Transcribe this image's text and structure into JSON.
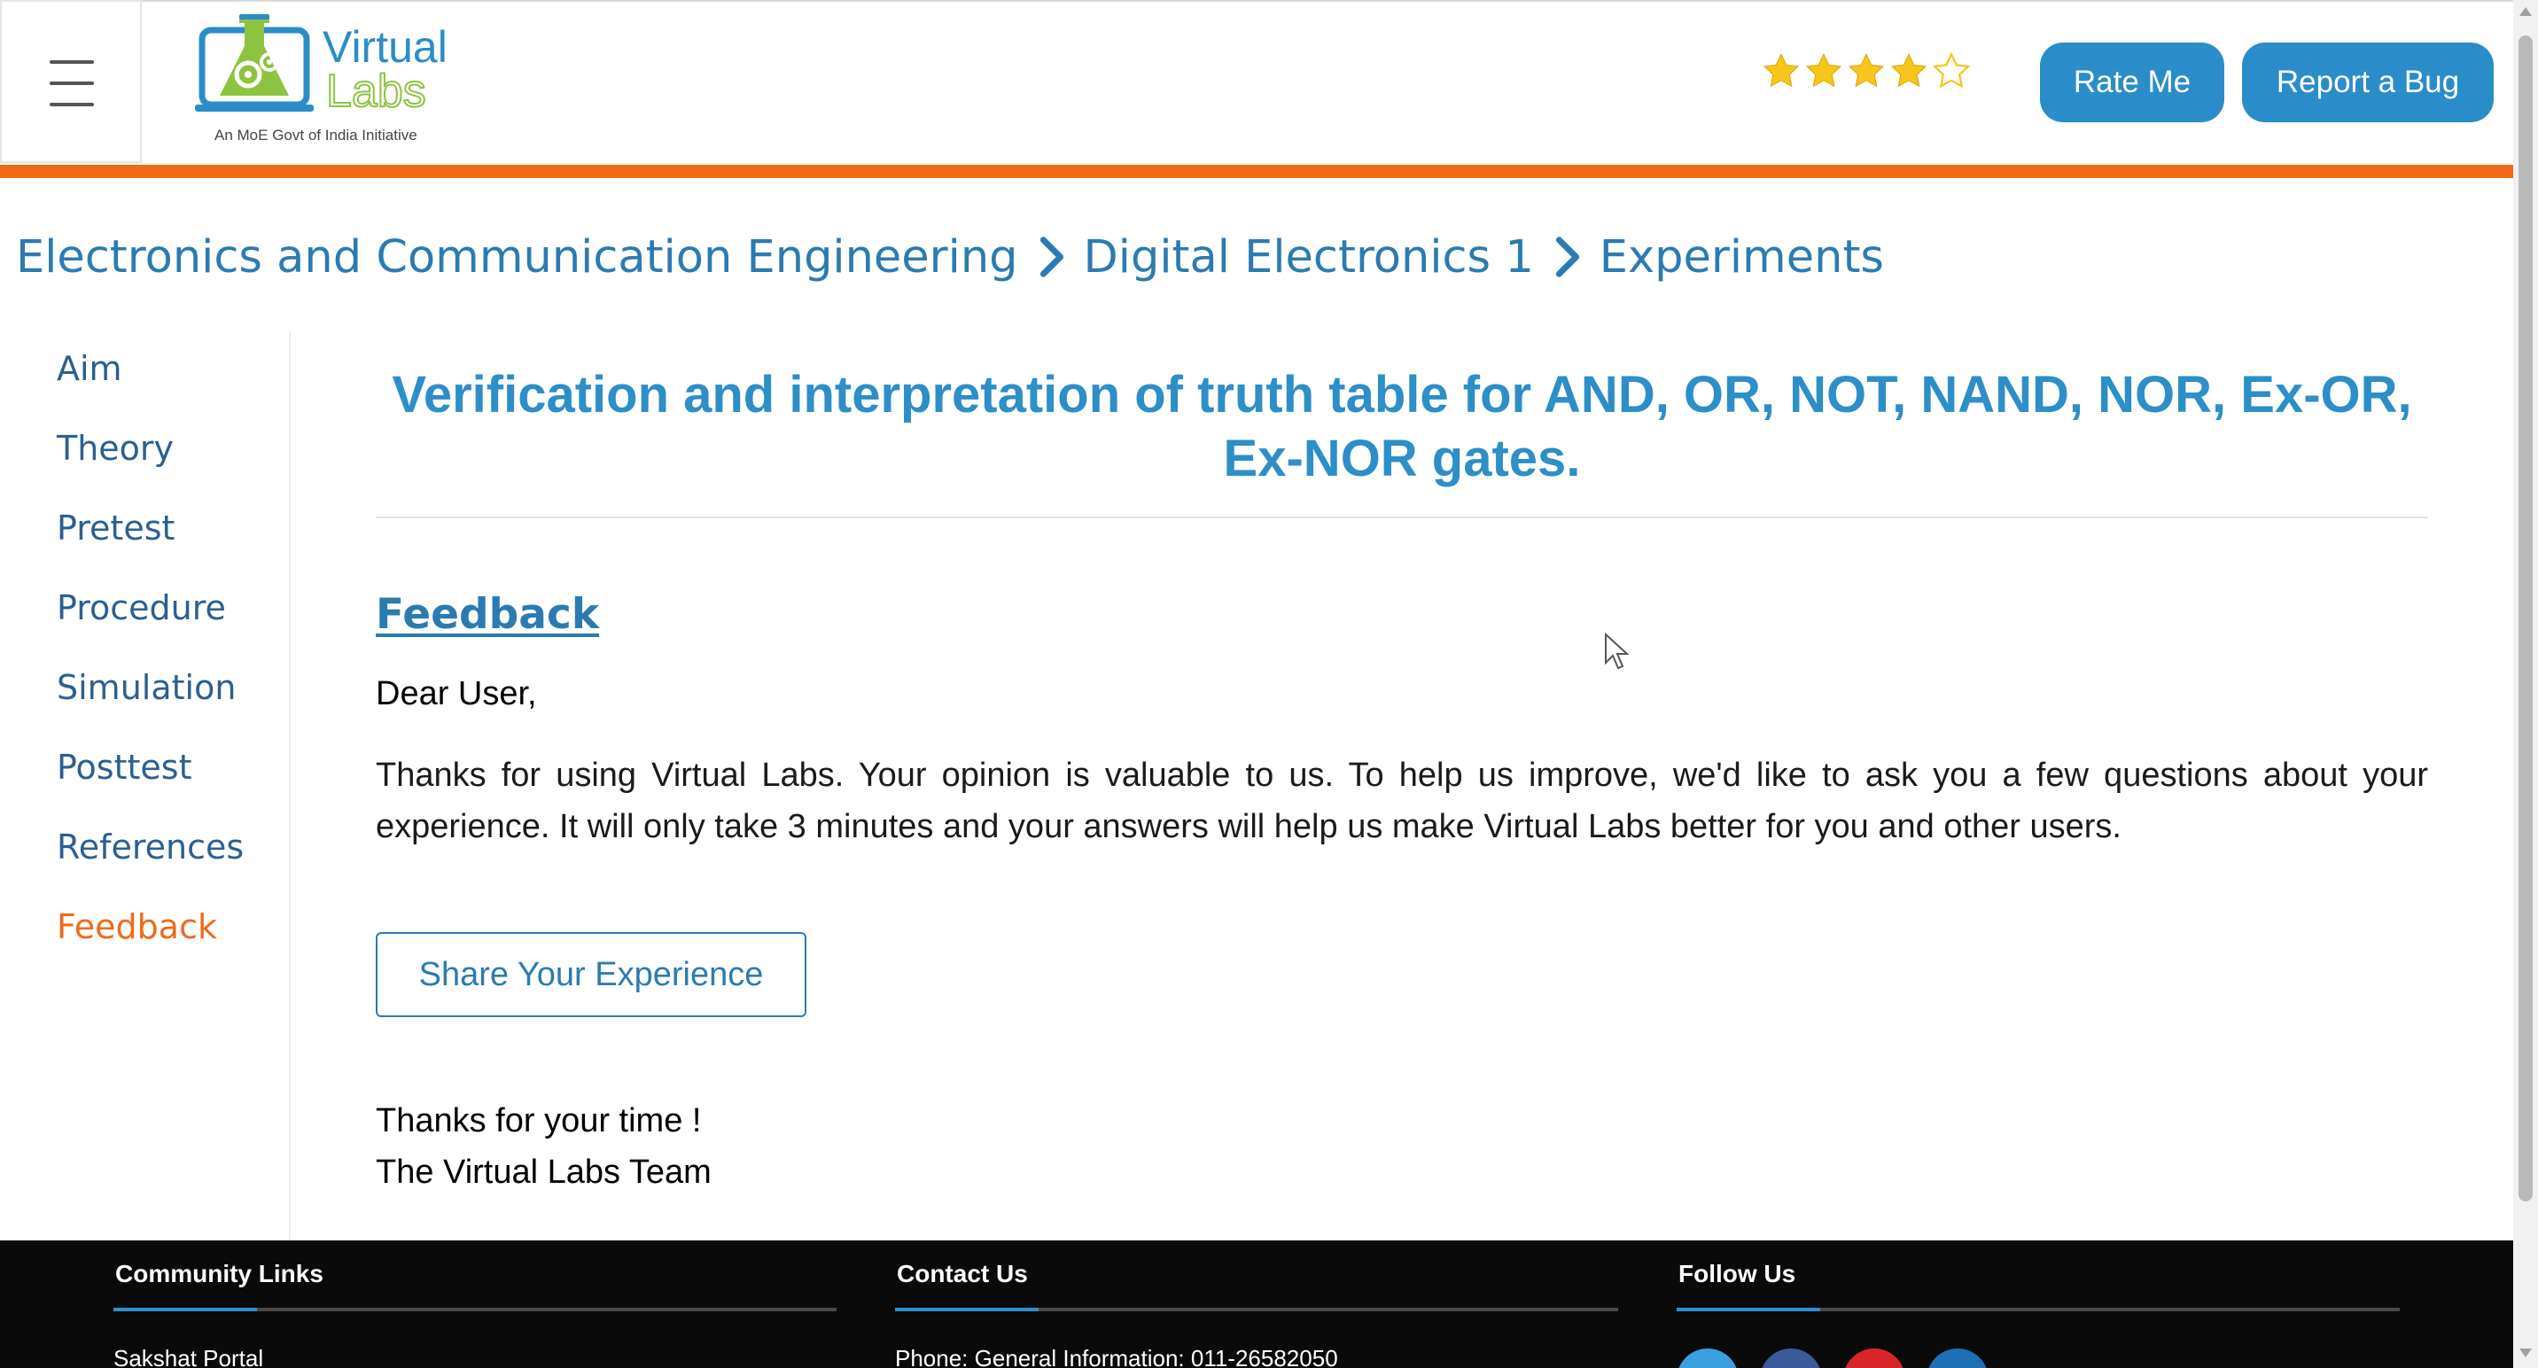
{
  "header": {
    "logo": {
      "line1": "Virtual",
      "line2": "Labs",
      "tagline": "An MoE Govt of India Initiative"
    },
    "rating": {
      "filled": 4,
      "total": 5
    },
    "rate_button": "Rate Me",
    "bug_button": "Report a Bug"
  },
  "breadcrumb": [
    "Electronics and Communication Engineering",
    "Digital Electronics 1",
    "Experiments"
  ],
  "sidebar": {
    "items": [
      {
        "label": "Aim"
      },
      {
        "label": "Theory"
      },
      {
        "label": "Pretest"
      },
      {
        "label": "Procedure"
      },
      {
        "label": "Simulation"
      },
      {
        "label": "Posttest"
      },
      {
        "label": "References"
      },
      {
        "label": "Feedback",
        "active": true
      }
    ]
  },
  "main": {
    "title": "Verification and interpretation of truth table for AND, OR, NOT, NAND, NOR, Ex-OR, Ex-NOR gates.",
    "section_heading": "Feedback",
    "greeting": "Dear User,",
    "message": "Thanks for using Virtual Labs. Your opinion is valuable to us. To help us improve, we'd like to ask you a few questions about your experience. It will only take 3 minutes and your answers will help us make Virtual Labs better for you and other users.",
    "share_button": "Share Your Experience",
    "closing": "Thanks for your time !",
    "signature": "The Virtual Labs Team"
  },
  "footer": {
    "community": {
      "heading": "Community Links",
      "first_link": "Sakshat Portal"
    },
    "contact": {
      "heading": "Contact Us",
      "phone": "Phone: General Information: 011-26582050"
    },
    "follow": {
      "heading": "Follow Us",
      "icons": [
        "twitter-icon",
        "facebook-icon",
        "youtube-icon",
        "linkedin-icon"
      ]
    }
  },
  "colors": {
    "accent_blue": "#2d8ec8",
    "link_blue": "#2b7bb1",
    "orange": "#f06a19",
    "button_blue": "#2a8dc9",
    "star_gold": "#f7c51c",
    "footer_bg": "#0a0a0a"
  }
}
